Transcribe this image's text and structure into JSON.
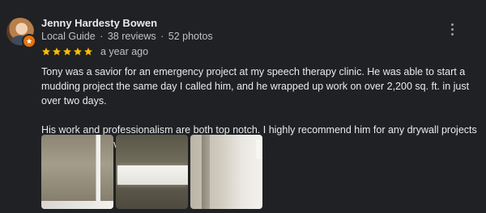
{
  "review": {
    "author_name": "Jenny Hardesty Bowen",
    "badge": "Local Guide",
    "reviews_count": "38 reviews",
    "photos_count": "52 photos",
    "separator": "·",
    "rating": 5,
    "rating_max": 5,
    "time_ago": "a year ago",
    "paragraphs": [
      "Tony was a savior for an emergency project at my speech therapy clinic. He was able to start a mudding project the same day I called him, and he wrapped up work on over 2,200 sq. ft. in just over two days.",
      "His work and professionalism are both top notch. I highly recommend him for any drywall projects that you may have!"
    ],
    "photos_visible": 3
  },
  "icons": {
    "more": "more-vert-icon",
    "star": "star-icon",
    "guide_badge": "local-guide-badge-icon"
  },
  "colors": {
    "background": "#202124",
    "text_primary": "#e8eaed",
    "text_secondary": "#bdc1c6",
    "star": "#fbbc04",
    "badge": "#e8710a"
  }
}
